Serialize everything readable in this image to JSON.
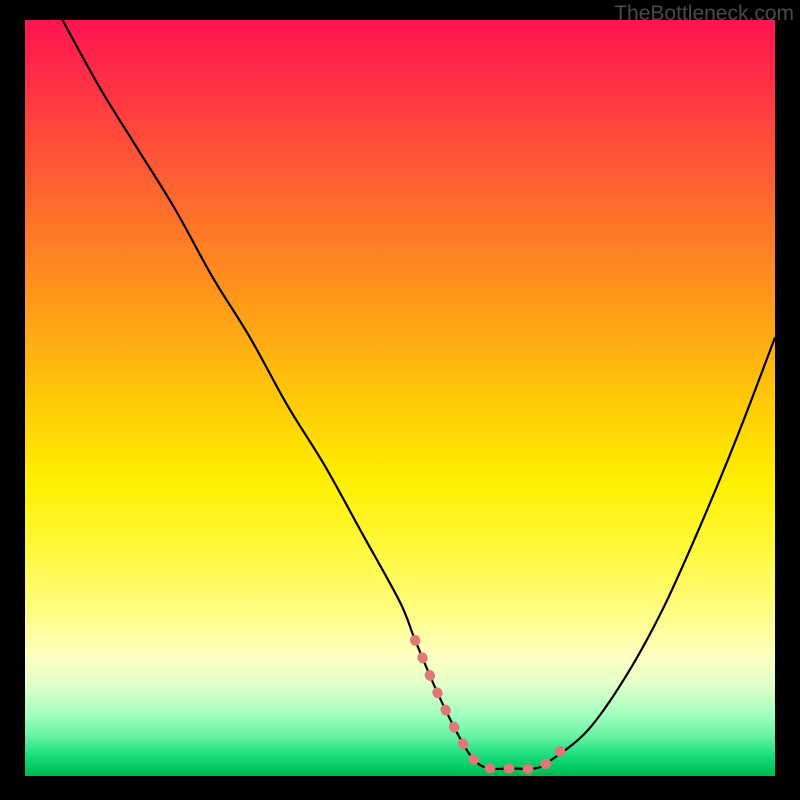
{
  "watermark": "TheBottleneck.com",
  "chart_data": {
    "type": "line",
    "title": "",
    "xlabel": "",
    "ylabel": "",
    "xlim": [
      0,
      100
    ],
    "ylim": [
      0,
      100
    ],
    "grid": false,
    "legend": false,
    "series": [
      {
        "name": "curve",
        "color": "#000000",
        "x": [
          5,
          10,
          15,
          20,
          25,
          30,
          35,
          40,
          45,
          50,
          52,
          55,
          58,
          60,
          62,
          65,
          68,
          70,
          75,
          80,
          85,
          90,
          95,
          100
        ],
        "y": [
          100,
          91,
          83,
          75,
          66,
          58,
          49,
          41,
          32,
          23,
          18,
          11,
          5,
          2,
          1,
          1,
          1,
          2,
          6,
          13,
          22,
          33,
          45,
          58
        ]
      }
    ],
    "highlight": {
      "name": "pink-segment",
      "color": "#e07878",
      "x": [
        52,
        55,
        58,
        60,
        62,
        65,
        68,
        70,
        73
      ],
      "y": [
        18,
        11,
        5,
        2,
        1,
        1,
        1,
        2,
        5
      ]
    }
  }
}
